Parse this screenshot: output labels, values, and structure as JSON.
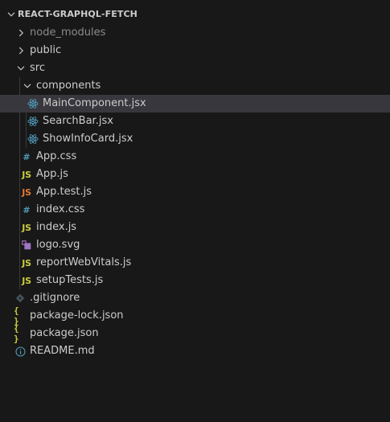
{
  "project": {
    "title": "REACT-GRAPHQL-FETCH"
  },
  "tree": {
    "node_modules": "node_modules",
    "public": "public",
    "src": "src",
    "components": "components",
    "main_component": "MainComponent.jsx",
    "search_bar": "SearchBar.jsx",
    "show_info_card": "ShowInfoCard.jsx",
    "app_css": "App.css",
    "app_js": "App.js",
    "app_test_js": "App.test.js",
    "index_css": "index.css",
    "index_js": "index.js",
    "logo_svg": "logo.svg",
    "report_web_vitals": "reportWebVitals.js",
    "setup_tests": "setupTests.js",
    "gitignore": ".gitignore",
    "package_lock": "package-lock.json",
    "package_json": "package.json",
    "readme": "README.md"
  },
  "icons": {
    "js_label": "JS",
    "css_label": "#",
    "json_label": "{ }",
    "js_color": "#cbcb41",
    "test_color": "#e37933",
    "css_color": "#519aba",
    "react_color": "#519aba",
    "svg_color": "#a074c4",
    "info_color": "#519aba"
  }
}
